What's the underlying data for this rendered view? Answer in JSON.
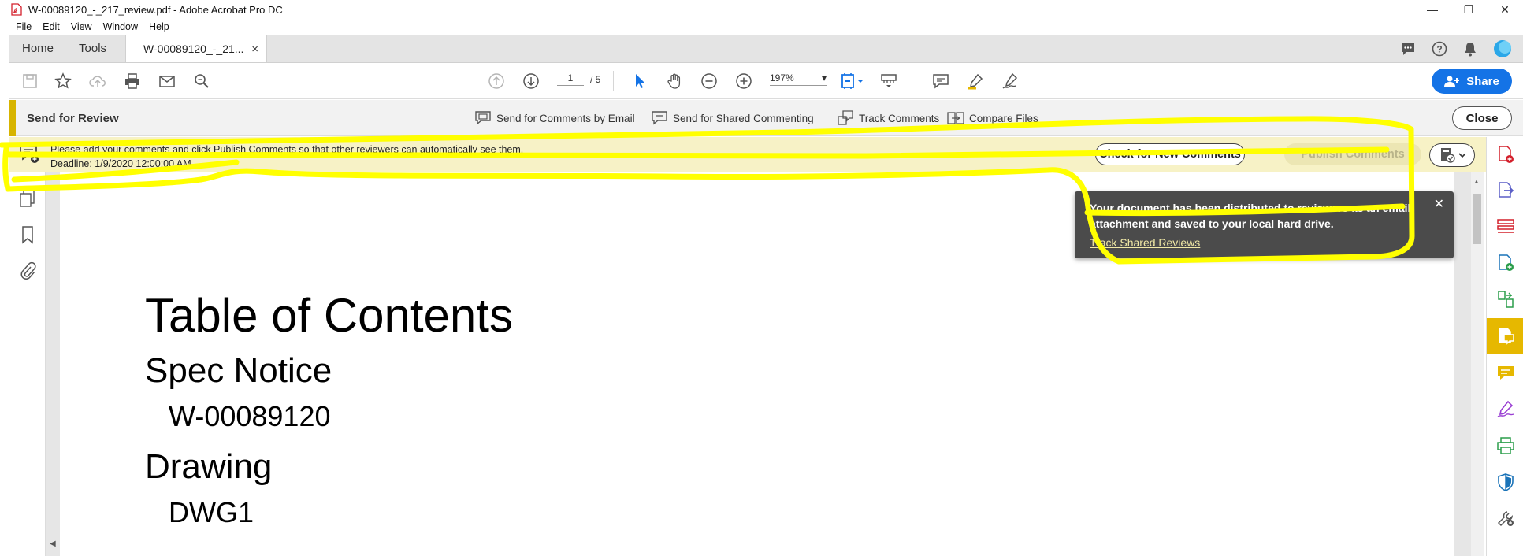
{
  "window": {
    "title": "W-00089120_-_217_review.pdf - Adobe Acrobat Pro DC",
    "controls": {
      "minimize": "—",
      "restore": "❐",
      "close": "✕"
    }
  },
  "menu": [
    "File",
    "Edit",
    "View",
    "Window",
    "Help"
  ],
  "tabs": {
    "home": "Home",
    "tools": "Tools",
    "document": "W-00089120_-_21...",
    "document_close": "×"
  },
  "toolbar": {
    "page_current": "1",
    "page_total": "/ 5",
    "zoom": "197%",
    "share_label": "Share"
  },
  "review": {
    "title": "Send for Review",
    "send_email": "Send for Comments by Email",
    "send_shared": "Send for Shared Commenting",
    "track": "Track Comments",
    "compare": "Compare Files",
    "close": "Close"
  },
  "notice": {
    "message": "Please add your comments and click Publish Comments so that other reviewers can automatically see them.",
    "deadline": "Deadline: 1/9/2020 12:00:00 AM",
    "check_button": "Check for New Comments",
    "publish_button": "Publish Comments"
  },
  "popup": {
    "message": "Your document has been distributed to reviewers as an email attachment and saved to your local hard drive.",
    "link": "Track Shared Reviews",
    "close": "✕"
  },
  "document": {
    "toc_title": "Table of Contents",
    "section1": "Spec Notice",
    "section1_item": "W-00089120",
    "section2": "Drawing",
    "section2_item": "DWG1"
  },
  "colors": {
    "accent_yellow": "#e6b800",
    "share_blue": "#1473e6",
    "highlighter": "#ffff00",
    "notice_bg": "#f7f2c6"
  }
}
